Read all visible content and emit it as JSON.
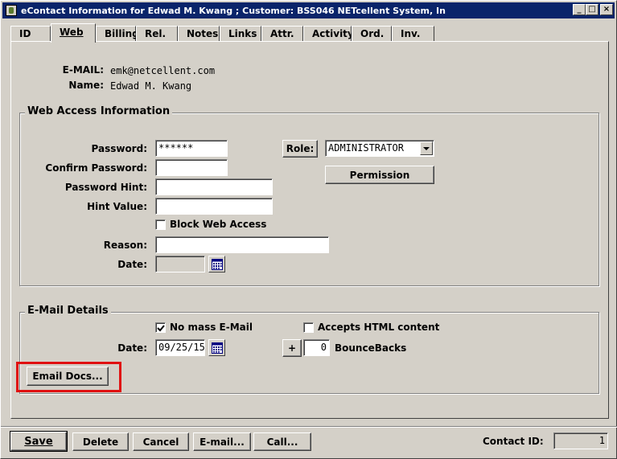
{
  "window": {
    "title": "eContact Information for Edwad M. Kwang ; Customer: BSS046 NETcellent System, In",
    "controls": {
      "minimize": "_",
      "maximize": "□",
      "close": "×"
    }
  },
  "tabs": [
    {
      "label": "ID",
      "active": false
    },
    {
      "label": "Web",
      "active": true
    },
    {
      "label": "Billing",
      "active": false
    },
    {
      "label": "Rel.",
      "active": false
    },
    {
      "label": "Notes",
      "active": false
    },
    {
      "label": "Links",
      "active": false
    },
    {
      "label": "Attr.",
      "active": false
    },
    {
      "label": "Activity",
      "active": false
    },
    {
      "label": "Ord.",
      "active": false
    },
    {
      "label": "Inv.",
      "active": false
    }
  ],
  "contact": {
    "email_label": "E-MAIL:",
    "email_value": "emk@netcellent.com",
    "name_label": "Name:",
    "name_value": "Edwad M. Kwang"
  },
  "web_access": {
    "title": "Web Access Information",
    "password_label": "Password:",
    "password_value": "******",
    "confirm_label": "Confirm Password:",
    "confirm_value": "",
    "hint_label": "Password Hint:",
    "hint_value": "",
    "hint_value_label": "Hint Value:",
    "hint_value_value": "",
    "block_label": "Block Web Access",
    "block_checked": false,
    "reason_label": "Reason:",
    "reason_value": "",
    "date_label": "Date:",
    "date_value": "",
    "role_button": "Role:",
    "role_value": "ADMINISTRATOR",
    "permission_button": "Permission"
  },
  "email_details": {
    "title": "E-Mail Details",
    "no_mass_label": "No mass E-Mail",
    "no_mass_checked": true,
    "accepts_html_label": "Accepts HTML content",
    "accepts_html_checked": false,
    "date_label": "Date:",
    "date_value": "09/25/15",
    "plus_button": "+",
    "bouncebacks_value": "0",
    "bouncebacks_label": "BounceBacks",
    "email_docs_button": "Email Docs..."
  },
  "footer": {
    "save": "Save",
    "delete": "Delete",
    "cancel": "Cancel",
    "email": "E-mail...",
    "call": "Call...",
    "contact_id_label": "Contact ID:",
    "contact_id_value": "1"
  },
  "colors": {
    "titlebar": "#0a246a",
    "face": "#d4d0c8",
    "highlight_box": "#e01010"
  }
}
